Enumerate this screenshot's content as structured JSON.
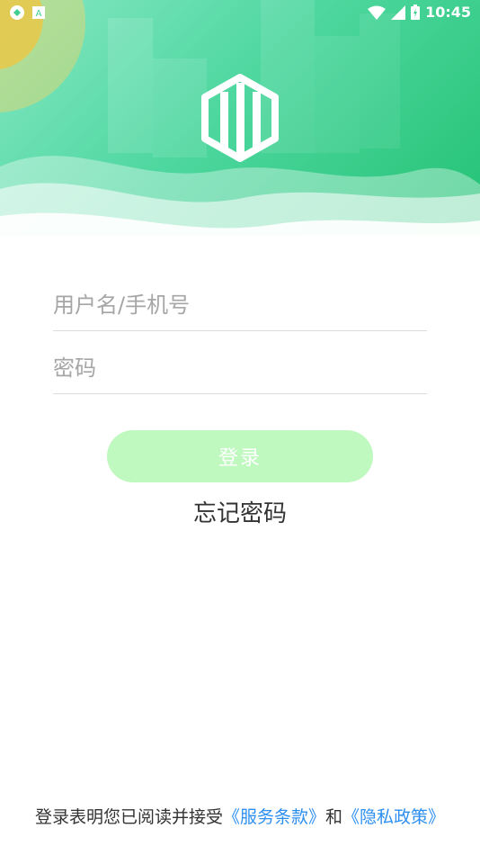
{
  "status_bar": {
    "time": "10:45",
    "left_icons": [
      "sync-icon",
      "keyboard-a-icon"
    ],
    "right_icons": [
      "wifi-icon",
      "signal-icon",
      "battery-icon"
    ]
  },
  "header": {
    "logo_icon": "building-logo-icon",
    "gradient_colors": [
      "#86e7c4",
      "#22c173"
    ]
  },
  "form": {
    "username_placeholder": "用户名/手机号",
    "password_placeholder": "密码",
    "login_label": "登录",
    "forgot_label": "忘记密码"
  },
  "agreement": {
    "prefix": "登录表明您已阅读并接受",
    "terms_link": "《服务条款》",
    "and_text": "和",
    "privacy_link": "《隐私政策》"
  },
  "colors": {
    "accent": "#2d8ff0",
    "button_bg": "#bff9bf",
    "header_green": "#22c173"
  }
}
